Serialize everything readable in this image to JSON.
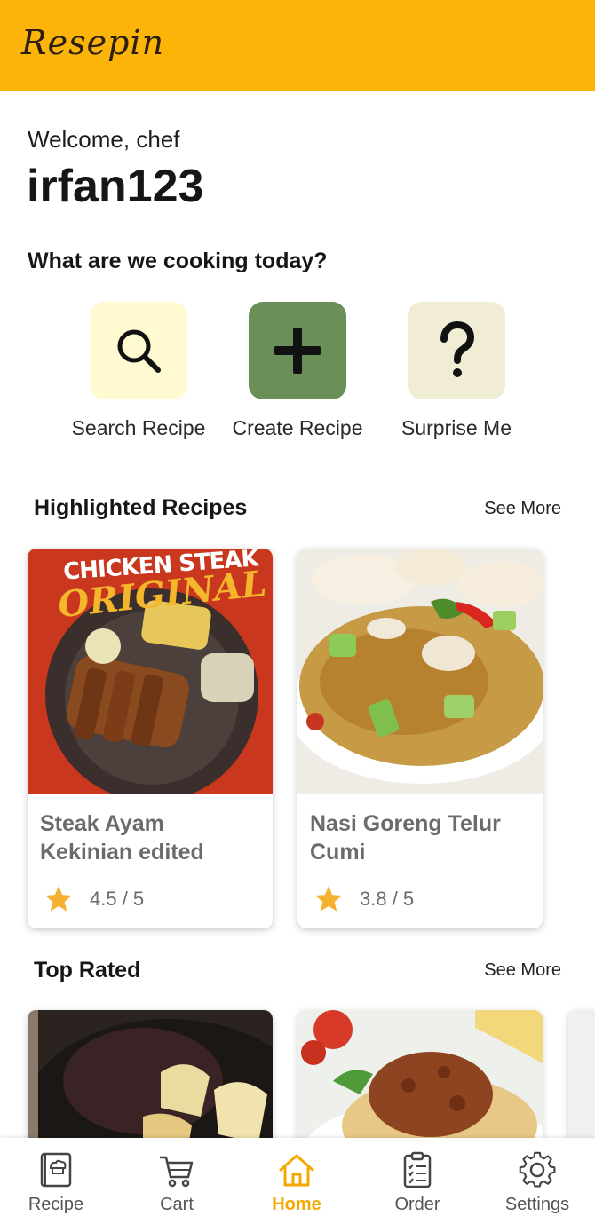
{
  "app": {
    "logo": "Resepin",
    "accent": "#FDB409"
  },
  "greeting": {
    "welcome": "Welcome, chef",
    "username": "irfan123"
  },
  "prompt": "What are we cooking today?",
  "actions": [
    {
      "label": "Search Recipe",
      "icon": "search-icon",
      "bg": "#FFFAD2"
    },
    {
      "label": "Create Recipe",
      "icon": "plus-icon",
      "bg": "#6B8F58"
    },
    {
      "label": "Surprise Me",
      "icon": "question-icon",
      "bg": "#F1EDD4"
    }
  ],
  "highlighted": {
    "title": "Highlighted Recipes",
    "see_more": "See More",
    "cards": [
      {
        "title": "Steak Ayam Kekinian edited",
        "rating": "4.5 / 5",
        "rating_value": 4.5,
        "image_text": [
          "CHICKEN STEAK",
          "ORIGINAL"
        ]
      },
      {
        "title": "Nasi Goreng Telur Cumi",
        "rating": "3.8 / 5",
        "rating_value": 3.8
      }
    ]
  },
  "top_rated": {
    "title": "Top Rated",
    "see_more": "See More"
  },
  "nav": {
    "items": [
      {
        "label": "Recipe",
        "icon": "recipe-book-icon"
      },
      {
        "label": "Cart",
        "icon": "cart-icon"
      },
      {
        "label": "Home",
        "icon": "home-icon",
        "active": true
      },
      {
        "label": "Order",
        "icon": "order-clipboard-icon"
      },
      {
        "label": "Settings",
        "icon": "gear-icon"
      }
    ],
    "active_color": "#F5A800"
  }
}
